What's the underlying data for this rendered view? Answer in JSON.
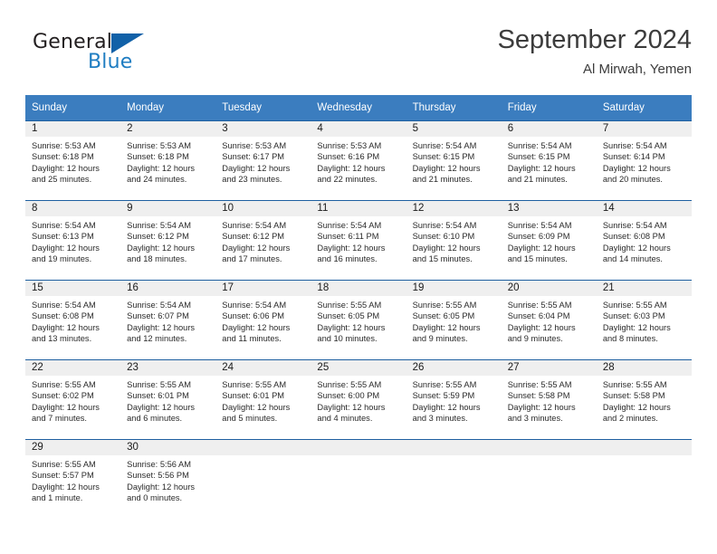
{
  "brand": {
    "name_dark": "General",
    "name_light": "Blue",
    "accent_dark": "#1161a8",
    "accent_light": "#1f7dc2"
  },
  "header": {
    "month_title": "September 2024",
    "location": "Al Mirwah, Yemen"
  },
  "calendar": {
    "header_bg": "#3b7dbf",
    "row_divider": "#1e5fa0",
    "daynum_bg": "#efefef",
    "weekdays": [
      "Sunday",
      "Monday",
      "Tuesday",
      "Wednesday",
      "Thursday",
      "Friday",
      "Saturday"
    ],
    "weeks": [
      [
        {
          "day": "1",
          "sunrise": "Sunrise: 5:53 AM",
          "sunset": "Sunset: 6:18 PM",
          "daylight": "Daylight: 12 hours and 25 minutes."
        },
        {
          "day": "2",
          "sunrise": "Sunrise: 5:53 AM",
          "sunset": "Sunset: 6:18 PM",
          "daylight": "Daylight: 12 hours and 24 minutes."
        },
        {
          "day": "3",
          "sunrise": "Sunrise: 5:53 AM",
          "sunset": "Sunset: 6:17 PM",
          "daylight": "Daylight: 12 hours and 23 minutes."
        },
        {
          "day": "4",
          "sunrise": "Sunrise: 5:53 AM",
          "sunset": "Sunset: 6:16 PM",
          "daylight": "Daylight: 12 hours and 22 minutes."
        },
        {
          "day": "5",
          "sunrise": "Sunrise: 5:54 AM",
          "sunset": "Sunset: 6:15 PM",
          "daylight": "Daylight: 12 hours and 21 minutes."
        },
        {
          "day": "6",
          "sunrise": "Sunrise: 5:54 AM",
          "sunset": "Sunset: 6:15 PM",
          "daylight": "Daylight: 12 hours and 21 minutes."
        },
        {
          "day": "7",
          "sunrise": "Sunrise: 5:54 AM",
          "sunset": "Sunset: 6:14 PM",
          "daylight": "Daylight: 12 hours and 20 minutes."
        }
      ],
      [
        {
          "day": "8",
          "sunrise": "Sunrise: 5:54 AM",
          "sunset": "Sunset: 6:13 PM",
          "daylight": "Daylight: 12 hours and 19 minutes."
        },
        {
          "day": "9",
          "sunrise": "Sunrise: 5:54 AM",
          "sunset": "Sunset: 6:12 PM",
          "daylight": "Daylight: 12 hours and 18 minutes."
        },
        {
          "day": "10",
          "sunrise": "Sunrise: 5:54 AM",
          "sunset": "Sunset: 6:12 PM",
          "daylight": "Daylight: 12 hours and 17 minutes."
        },
        {
          "day": "11",
          "sunrise": "Sunrise: 5:54 AM",
          "sunset": "Sunset: 6:11 PM",
          "daylight": "Daylight: 12 hours and 16 minutes."
        },
        {
          "day": "12",
          "sunrise": "Sunrise: 5:54 AM",
          "sunset": "Sunset: 6:10 PM",
          "daylight": "Daylight: 12 hours and 15 minutes."
        },
        {
          "day": "13",
          "sunrise": "Sunrise: 5:54 AM",
          "sunset": "Sunset: 6:09 PM",
          "daylight": "Daylight: 12 hours and 15 minutes."
        },
        {
          "day": "14",
          "sunrise": "Sunrise: 5:54 AM",
          "sunset": "Sunset: 6:08 PM",
          "daylight": "Daylight: 12 hours and 14 minutes."
        }
      ],
      [
        {
          "day": "15",
          "sunrise": "Sunrise: 5:54 AM",
          "sunset": "Sunset: 6:08 PM",
          "daylight": "Daylight: 12 hours and 13 minutes."
        },
        {
          "day": "16",
          "sunrise": "Sunrise: 5:54 AM",
          "sunset": "Sunset: 6:07 PM",
          "daylight": "Daylight: 12 hours and 12 minutes."
        },
        {
          "day": "17",
          "sunrise": "Sunrise: 5:54 AM",
          "sunset": "Sunset: 6:06 PM",
          "daylight": "Daylight: 12 hours and 11 minutes."
        },
        {
          "day": "18",
          "sunrise": "Sunrise: 5:55 AM",
          "sunset": "Sunset: 6:05 PM",
          "daylight": "Daylight: 12 hours and 10 minutes."
        },
        {
          "day": "19",
          "sunrise": "Sunrise: 5:55 AM",
          "sunset": "Sunset: 6:05 PM",
          "daylight": "Daylight: 12 hours and 9 minutes."
        },
        {
          "day": "20",
          "sunrise": "Sunrise: 5:55 AM",
          "sunset": "Sunset: 6:04 PM",
          "daylight": "Daylight: 12 hours and 9 minutes."
        },
        {
          "day": "21",
          "sunrise": "Sunrise: 5:55 AM",
          "sunset": "Sunset: 6:03 PM",
          "daylight": "Daylight: 12 hours and 8 minutes."
        }
      ],
      [
        {
          "day": "22",
          "sunrise": "Sunrise: 5:55 AM",
          "sunset": "Sunset: 6:02 PM",
          "daylight": "Daylight: 12 hours and 7 minutes."
        },
        {
          "day": "23",
          "sunrise": "Sunrise: 5:55 AM",
          "sunset": "Sunset: 6:01 PM",
          "daylight": "Daylight: 12 hours and 6 minutes."
        },
        {
          "day": "24",
          "sunrise": "Sunrise: 5:55 AM",
          "sunset": "Sunset: 6:01 PM",
          "daylight": "Daylight: 12 hours and 5 minutes."
        },
        {
          "day": "25",
          "sunrise": "Sunrise: 5:55 AM",
          "sunset": "Sunset: 6:00 PM",
          "daylight": "Daylight: 12 hours and 4 minutes."
        },
        {
          "day": "26",
          "sunrise": "Sunrise: 5:55 AM",
          "sunset": "Sunset: 5:59 PM",
          "daylight": "Daylight: 12 hours and 3 minutes."
        },
        {
          "day": "27",
          "sunrise": "Sunrise: 5:55 AM",
          "sunset": "Sunset: 5:58 PM",
          "daylight": "Daylight: 12 hours and 3 minutes."
        },
        {
          "day": "28",
          "sunrise": "Sunrise: 5:55 AM",
          "sunset": "Sunset: 5:58 PM",
          "daylight": "Daylight: 12 hours and 2 minutes."
        }
      ],
      [
        {
          "day": "29",
          "sunrise": "Sunrise: 5:55 AM",
          "sunset": "Sunset: 5:57 PM",
          "daylight": "Daylight: 12 hours and 1 minute."
        },
        {
          "day": "30",
          "sunrise": "Sunrise: 5:56 AM",
          "sunset": "Sunset: 5:56 PM",
          "daylight": "Daylight: 12 hours and 0 minutes."
        },
        {
          "day": "",
          "sunrise": "",
          "sunset": "",
          "daylight": ""
        },
        {
          "day": "",
          "sunrise": "",
          "sunset": "",
          "daylight": ""
        },
        {
          "day": "",
          "sunrise": "",
          "sunset": "",
          "daylight": ""
        },
        {
          "day": "",
          "sunrise": "",
          "sunset": "",
          "daylight": ""
        },
        {
          "day": "",
          "sunrise": "",
          "sunset": "",
          "daylight": ""
        }
      ]
    ]
  }
}
